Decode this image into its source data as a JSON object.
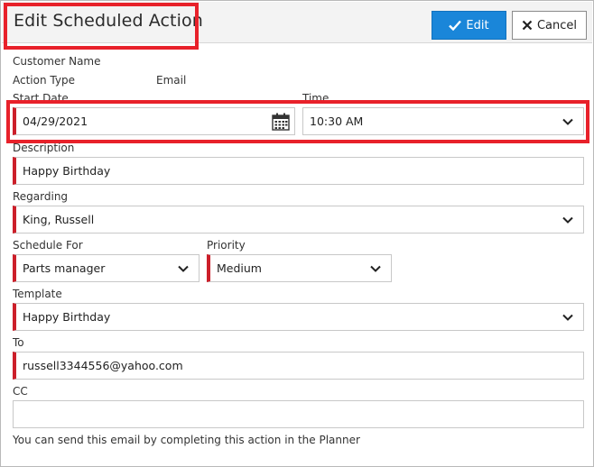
{
  "dialog": {
    "title": "Edit Scheduled Action",
    "edit_label": "Edit",
    "cancel_label": "Cancel"
  },
  "form": {
    "customer_name_label": "Customer Name",
    "action_type_label": "Action Type",
    "action_type_value": "Email",
    "start_date_label": "Start Date",
    "start_date_value": "04/29/2021",
    "time_label": "Time",
    "time_value": "10:30 AM",
    "description_label": "Description",
    "description_value": "Happy Birthday",
    "regarding_label": "Regarding",
    "regarding_value": "King, Russell",
    "schedule_for_label": "Schedule For",
    "schedule_for_value": "Parts manager",
    "priority_label": "Priority",
    "priority_value": "Medium",
    "template_label": "Template",
    "template_value": "Happy Birthday",
    "to_label": "To",
    "to_value": "russell3344556@yahoo.com",
    "cc_label": "CC",
    "cc_value": ""
  },
  "footer": {
    "note": "You can send this email by completing this action in the Planner"
  },
  "icons": {
    "edit": "check-icon",
    "cancel": "close-icon",
    "date": "calendar-icon",
    "dropdown": "chevron-down-icon"
  },
  "colors": {
    "primary": "#1a86d9",
    "required": "#cc1f2a",
    "highlight": "#e8212a"
  }
}
